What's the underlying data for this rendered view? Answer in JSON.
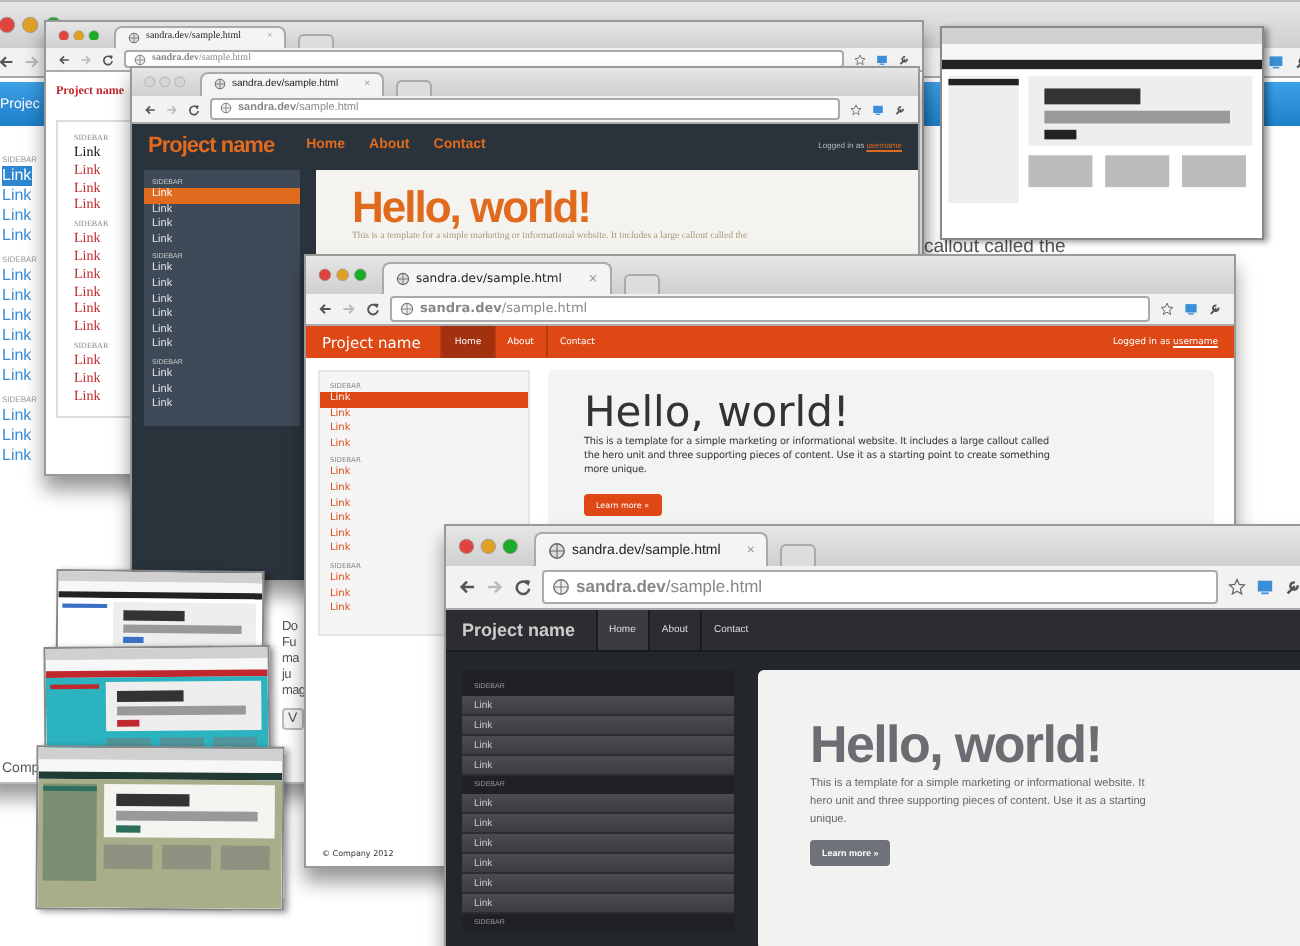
{
  "windows": [
    {
      "kind": "blue",
      "active": true,
      "brand": "Projec",
      "sidebar": [
        {
          "heading": "SIDEBAR",
          "links": [
            {
              "label": "Link",
              "selected": true
            },
            {
              "label": "Link",
              "selected": false
            },
            {
              "label": "Link",
              "selected": false
            },
            {
              "label": "Link",
              "selected": false
            }
          ]
        },
        {
          "heading": "SIDEBAR",
          "links": [
            {
              "label": "Link",
              "selected": false
            },
            {
              "label": "Link",
              "selected": false
            },
            {
              "label": "Link",
              "selected": false
            },
            {
              "label": "Link",
              "selected": false
            },
            {
              "label": "Link",
              "selected": false
            },
            {
              "label": "Link",
              "selected": false
            }
          ]
        },
        {
          "heading": "SIDEBAR",
          "links": [
            {
              "label": "Link",
              "selected": false
            },
            {
              "label": "Link",
              "selected": false
            },
            {
              "label": "Link",
              "selected": false
            }
          ]
        }
      ],
      "hero_lines": [
        "callout called the"
      ],
      "column_lines": [
        "Do",
        "Fu",
        "ma",
        "ju",
        "mag"
      ],
      "column_button": "V",
      "footer": "Comp"
    },
    {
      "kind": "serif",
      "active": true,
      "tab": "sandra.dev/sample.html",
      "tab_close": "×",
      "url": "**sandra.dev**/sample.html",
      "brand": "Project name",
      "sidebar": [
        {
          "heading": "SIDEBAR",
          "links": [
            {
              "label": "Link",
              "selected": true
            },
            {
              "label": "Link",
              "selected": false
            },
            {
              "label": "Link",
              "selected": false
            },
            {
              "label": "Link",
              "selected": false
            }
          ]
        },
        {
          "heading": "SIDEBAR",
          "links": [
            {
              "label": "Link",
              "selected": false
            },
            {
              "label": "Link",
              "selected": false
            },
            {
              "label": "Link",
              "selected": false
            },
            {
              "label": "Link",
              "selected": false
            },
            {
              "label": "Link",
              "selected": false
            },
            {
              "label": "Link",
              "selected": false
            }
          ]
        },
        {
          "heading": "SIDEBAR",
          "links": [
            {
              "label": "Link",
              "selected": false
            },
            {
              "label": "Link",
              "selected": false
            },
            {
              "label": "Link",
              "selected": false
            }
          ]
        }
      ]
    },
    {
      "kind": "dark",
      "active": false,
      "tab": "sandra.dev/sample.html",
      "tab_close": "×",
      "url": "**sandra.dev**/sample.html",
      "brand": "Project name",
      "nav": [
        {
          "label": "Home",
          "selected": false
        },
        {
          "label": "About",
          "selected": false
        },
        {
          "label": "Contact",
          "selected": false
        }
      ],
      "login_text": "Logged in as",
      "login_link": "username",
      "sidebar": [
        {
          "heading": "SIDEBAR",
          "links": [
            {
              "label": "Link",
              "selected": true
            },
            {
              "label": "Link",
              "selected": false
            },
            {
              "label": "Link",
              "selected": false
            },
            {
              "label": "Link",
              "selected": false
            }
          ]
        },
        {
          "heading": "SIDEBAR",
          "links": [
            {
              "label": "Link",
              "selected": false
            },
            {
              "label": "Link",
              "selected": false
            },
            {
              "label": "Link",
              "selected": false
            },
            {
              "label": "Link",
              "selected": false
            },
            {
              "label": "Link",
              "selected": false
            },
            {
              "label": "Link",
              "selected": false
            }
          ]
        },
        {
          "heading": "SIDEBAR",
          "links": [
            {
              "label": "Link",
              "selected": false
            },
            {
              "label": "Link",
              "selected": false
            },
            {
              "label": "Link",
              "selected": false
            }
          ]
        }
      ],
      "hero_title": "Hello, world!",
      "hero_lines": [
        "This is a template for a simple marketing or informational website. It includes a large callout called the"
      ]
    },
    {
      "kind": "orange",
      "active": true,
      "tab": "sandra.dev/sample.html",
      "tab_close": "×",
      "url": "**sandra.dev**/sample.html",
      "brand": "Project name",
      "nav": [
        {
          "label": "Home",
          "selected": true
        },
        {
          "label": "About",
          "selected": false
        },
        {
          "label": "Contact",
          "selected": false
        }
      ],
      "login_text": "Logged in as",
      "login_link": "username",
      "sidebar": [
        {
          "heading": "SIDEBAR",
          "links": [
            {
              "label": "Link",
              "selected": true
            },
            {
              "label": "Link",
              "selected": false
            },
            {
              "label": "Link",
              "selected": false
            },
            {
              "label": "Link",
              "selected": false
            }
          ]
        },
        {
          "heading": "SIDEBAR",
          "links": [
            {
              "label": "Link",
              "selected": false
            },
            {
              "label": "Link",
              "selected": false
            },
            {
              "label": "Link",
              "selected": false
            },
            {
              "label": "Link",
              "selected": false
            },
            {
              "label": "Link",
              "selected": false
            },
            {
              "label": "Link",
              "selected": false
            }
          ]
        },
        {
          "heading": "SIDEBAR",
          "links": [
            {
              "label": "Link",
              "selected": false
            },
            {
              "label": "Link",
              "selected": false
            },
            {
              "label": "Link",
              "selected": false
            }
          ]
        }
      ],
      "hero_title": "Hello, world!",
      "hero_lines": [
        "This is a template for a simple marketing or informational website. It includes a large callout called",
        "the hero unit and three supporting pieces of content. Use it as a starting point to create something",
        "more unique."
      ],
      "hero_button": "Learn more »",
      "footer": "© Company 2012"
    },
    {
      "kind": "gray",
      "active": true,
      "tab": "sandra.dev/sample.html",
      "tab_close": "×",
      "url": "**sandra.dev**/sample.html",
      "brand": "Project name",
      "nav": [
        {
          "label": "Home",
          "selected": true
        },
        {
          "label": "About",
          "selected": false
        },
        {
          "label": "Contact",
          "selected": false
        }
      ],
      "sidebar": [
        {
          "heading": "SIDEBAR",
          "links": [
            {
              "label": "Link",
              "selected": false
            },
            {
              "label": "Link",
              "selected": false
            },
            {
              "label": "Link",
              "selected": false
            },
            {
              "label": "Link",
              "selected": false
            }
          ]
        },
        {
          "heading": "SIDEBAR",
          "links": [
            {
              "label": "Link",
              "selected": false
            },
            {
              "label": "Link",
              "selected": false
            },
            {
              "label": "Link",
              "selected": false
            },
            {
              "label": "Link",
              "selected": false
            },
            {
              "label": "Link",
              "selected": false
            },
            {
              "label": "Link",
              "selected": false
            }
          ]
        },
        {
          "heading": "SIDEBAR"
        }
      ],
      "hero_title": "Hello, world!",
      "hero_lines": [
        "This is a template for a simple marketing or informational website. It",
        "hero unit and three supporting pieces of content. Use it as a starting",
        "unique."
      ],
      "hero_button": "Learn more »"
    }
  ]
}
